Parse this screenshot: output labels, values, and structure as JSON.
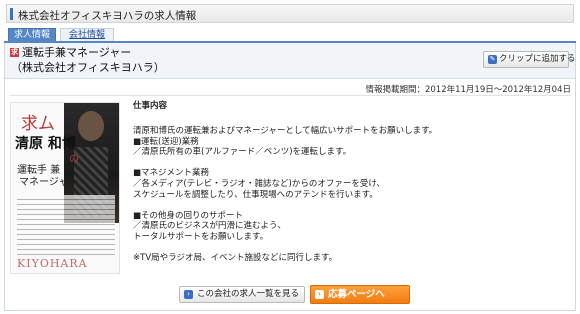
{
  "page": {
    "title": "株式会社オフィスキヨハラの求人情報"
  },
  "tabs": [
    {
      "label": "求人情報",
      "active": true
    },
    {
      "label": "会社情報",
      "active": false
    }
  ],
  "job": {
    "icon_glyph": "求",
    "title": "運転手兼マネージャー",
    "company": "（株式会社オフィスキヨハラ）",
    "clip_button": "クリップに追加する",
    "period": "情報掲載期間：2012年11月19日～2012年12月04日"
  },
  "photo": {
    "line1": "求ム",
    "line2": "清原 和博",
    "line3": "の",
    "line4": "運転手 兼",
    "line5": "マネージャー",
    "stamp": "KIYOHARA"
  },
  "content": {
    "section_title": "仕事内容",
    "body": "清原和博氏の運転兼およびマネージャーとして幅広いサポートをお願いします。\n■運転(送迎)業務\n／清原氏所有の車(アルファード／ベンツ)を運転します。\n\n■マネジメント業務\n／各メディア(テレビ・ラジオ・雑誌など)からのオファーを受け、\nスケジュールを調整したり、仕事現場へのアテンドを行います。\n\n■その他身の回りのサポート\n／清原氏のビジネスが円滑に進むよう、\nトータルサポートをお願いします。\n\n※TV局やラジオ局、イベント施設などに同行します。"
  },
  "buttons": {
    "company_jobs": "この会社の求人一覧を見る",
    "apply": "応募ページへ"
  },
  "colors": {
    "accent_blue": "#5586c5",
    "apply_orange": "#f07d10"
  }
}
